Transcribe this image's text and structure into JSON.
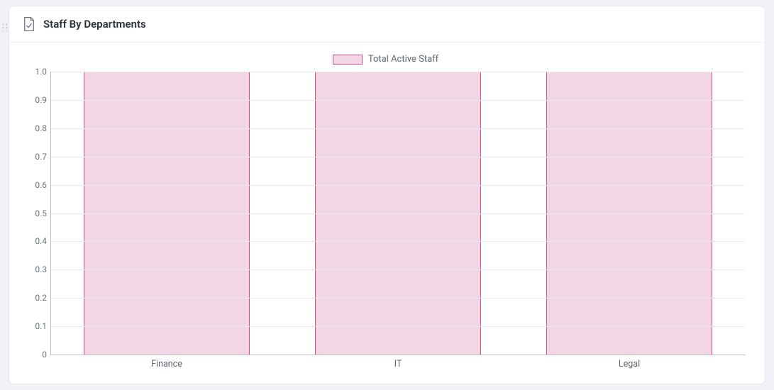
{
  "header": {
    "title": "Staff By Departments"
  },
  "legend": {
    "label": "Total Active Staff"
  },
  "chart_data": {
    "type": "bar",
    "title": "Staff By Departments",
    "xlabel": "",
    "ylabel": "",
    "categories": [
      "Finance",
      "IT",
      "Legal"
    ],
    "series": [
      {
        "name": "Total Active Staff",
        "values": [
          1,
          1,
          1
        ]
      }
    ],
    "ylim": [
      0,
      1.0
    ],
    "y_ticks": [
      0,
      0.1,
      0.2,
      0.3,
      0.4,
      0.5,
      0.6,
      0.7,
      0.8,
      0.9,
      1.0
    ],
    "grid": true,
    "legend_position": "top",
    "colors": {
      "bar_fill": "#f3d6e3",
      "bar_stroke": "#d65091"
    }
  }
}
